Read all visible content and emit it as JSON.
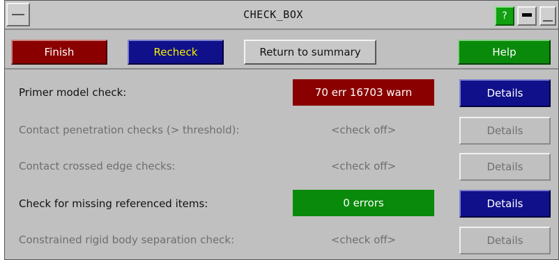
{
  "window": {
    "title": "CHECK_BOX",
    "help_icon_label": "?"
  },
  "toolbar": {
    "finish_label": "Finish",
    "recheck_label": "Recheck",
    "return_label": "Return to summary",
    "help_label": "Help"
  },
  "checks": [
    {
      "label": "Primer model check:",
      "status": "70 err 16703 warn",
      "details_label": "Details",
      "enabled": true,
      "status_color": "#8a0000"
    },
    {
      "label": "Contact penetration checks (> threshold):",
      "status": "<check off>",
      "details_label": "Details",
      "enabled": false
    },
    {
      "label": "Contact crossed edge checks:",
      "status": "<check off>",
      "details_label": "Details",
      "enabled": false
    },
    {
      "label": "Check for missing referenced items:",
      "status": "0 errors",
      "details_label": "Details",
      "enabled": true,
      "status_color": "#0a8a0a"
    },
    {
      "label": "Constrained rigid body separation check:",
      "status": "<check off>",
      "details_label": "Details",
      "enabled": false
    }
  ],
  "colors": {
    "background": "#c0c0c0",
    "red": "#8a0000",
    "blue": "#10108a",
    "green": "#0a8a0a"
  }
}
